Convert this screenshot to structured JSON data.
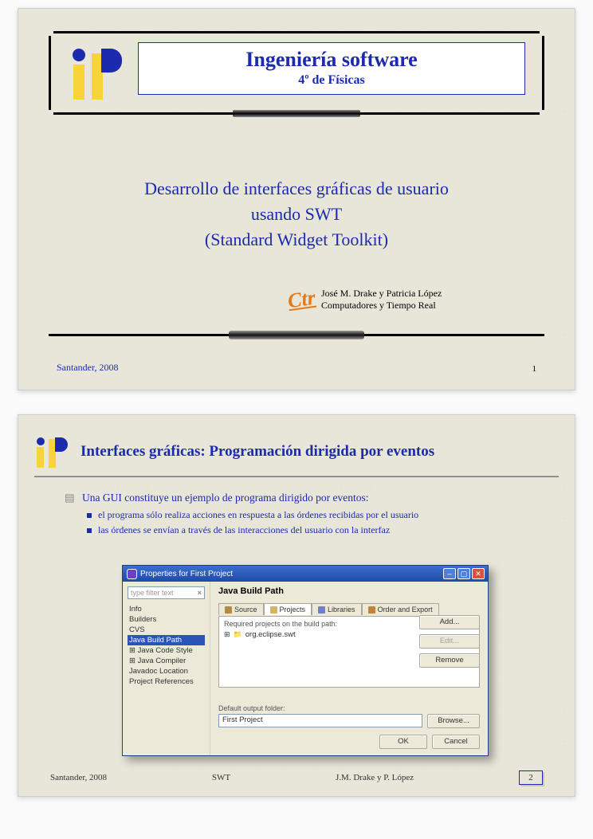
{
  "slide1": {
    "course_title": "Ingeniería software",
    "course_sub": "4º de Físicas",
    "main_title_l1": "Desarrollo de interfaces gráficas de usuario",
    "main_title_l2": "usando SWT",
    "main_title_l3": "(Standard Widget Toolkit)",
    "ctr_label": "Ctr",
    "authors": "José M. Drake y Patricia López",
    "dept": "Computadores y Tiempo Real",
    "footer_left": "Santander, 2008",
    "page": "1"
  },
  "slide2": {
    "heading": "Interfaces gráficas: Programación dirigida por eventos",
    "bullet1": "Una GUI constituye un ejemplo de programa dirigido por eventos:",
    "bullet1a": "el programa sólo realiza acciones en respuesta a las órdenes recibidas por el usuario",
    "bullet1b": "las órdenes se envían a través de las interacciones del usuario con la interfaz",
    "dialog": {
      "title": "Properties for First Project",
      "filter_placeholder": "type filter text",
      "tree": [
        "Info",
        "Builders",
        "CVS",
        "Java Build Path",
        "Java Code Style",
        "Java Compiler",
        "Javadoc Location",
        "Project References"
      ],
      "tree_selected_index": 3,
      "panel_title": "Java Build Path",
      "tabs": [
        "Source",
        "Projects",
        "Libraries",
        "Order and Export"
      ],
      "active_tab_index": 1,
      "req_label": "Required projects on the build path:",
      "req_item": "org.eclipse.swt",
      "btn_add": "Add...",
      "btn_edit": "Edit...",
      "btn_remove": "Remove",
      "def_label": "Default output folder:",
      "def_value": "First Project",
      "btn_browse": "Browse...",
      "btn_ok": "OK",
      "btn_cancel": "Cancel"
    },
    "footer_left": "Santander, 2008",
    "footer_mid": "SWT",
    "footer_right": "J.M. Drake y P. López",
    "page": "2"
  }
}
